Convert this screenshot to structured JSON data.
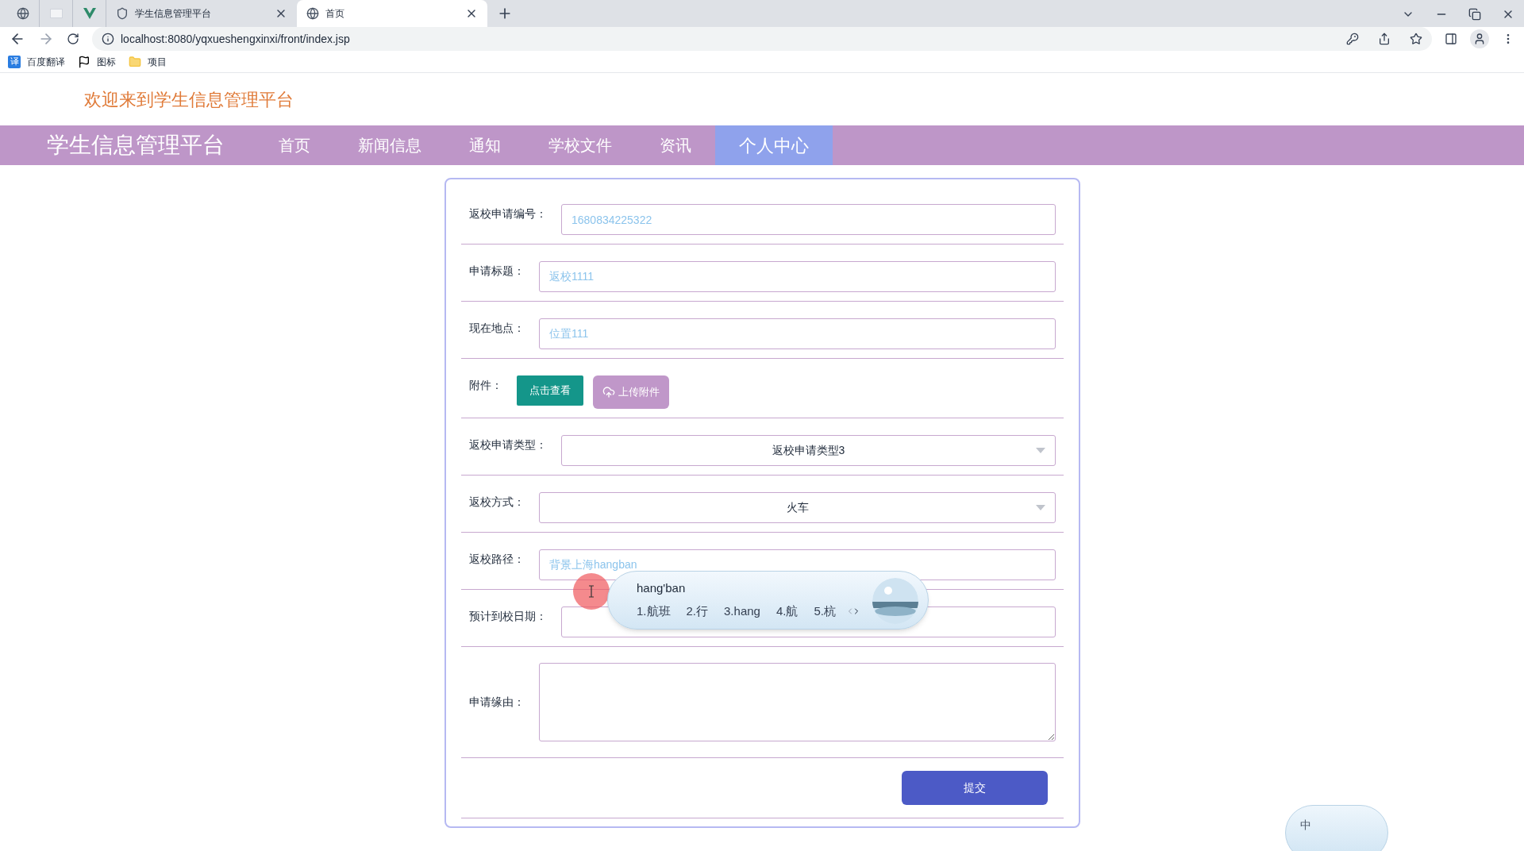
{
  "browser": {
    "tabs": [
      {
        "kind": "icon",
        "selected": false
      },
      {
        "kind": "icon",
        "selected": false
      },
      {
        "kind": "icon",
        "selected": false
      },
      {
        "kind": "titled",
        "title": "学生信息管理平台",
        "selected": false
      },
      {
        "kind": "titled",
        "title": "首页",
        "selected": true
      }
    ],
    "address": "localhost:8080/yqxueshengxinxi/front/index.jsp",
    "bookmarks": [
      {
        "label": "百度翻译",
        "badge": "译"
      },
      {
        "label": "图标"
      },
      {
        "label": "项目"
      }
    ]
  },
  "header": {
    "welcome": "欢迎来到学生信息管理平台"
  },
  "nav": {
    "brand": "学生信息管理平台",
    "items": [
      {
        "label": "首页",
        "selected": false
      },
      {
        "label": "新闻信息",
        "selected": false
      },
      {
        "label": "通知",
        "selected": false
      },
      {
        "label": "学校文件",
        "selected": false
      },
      {
        "label": "资讯",
        "selected": false
      },
      {
        "label": "个人中心",
        "selected": true
      }
    ]
  },
  "form": {
    "rows": [
      {
        "kind": "input",
        "label": "返校申请编号：",
        "value": "1680834225322"
      },
      {
        "kind": "input",
        "label": "申请标题：",
        "value": "返校1111"
      },
      {
        "kind": "input",
        "label": "现在地点：",
        "value": "位置111"
      },
      {
        "kind": "buttons",
        "label": "附件：",
        "buttons": [
          "点击查看",
          "上传附件"
        ]
      },
      {
        "kind": "select",
        "label": "返校申请类型：",
        "value": "返校申请类型3"
      },
      {
        "kind": "select",
        "label": "返校方式：",
        "value": "火车"
      },
      {
        "kind": "input",
        "label": "返校路径：",
        "value": "背景上海hangban"
      },
      {
        "kind": "input",
        "label": "预计到校日期："
      },
      {
        "kind": "textarea",
        "label": "申请缘由："
      },
      {
        "kind": "submit",
        "button": "提交"
      }
    ]
  },
  "ime": {
    "composition": "hang'ban",
    "candidates": [
      "1.航班",
      "2.行",
      "3.hang",
      "4.航",
      "5.杭"
    ],
    "status": "中"
  }
}
